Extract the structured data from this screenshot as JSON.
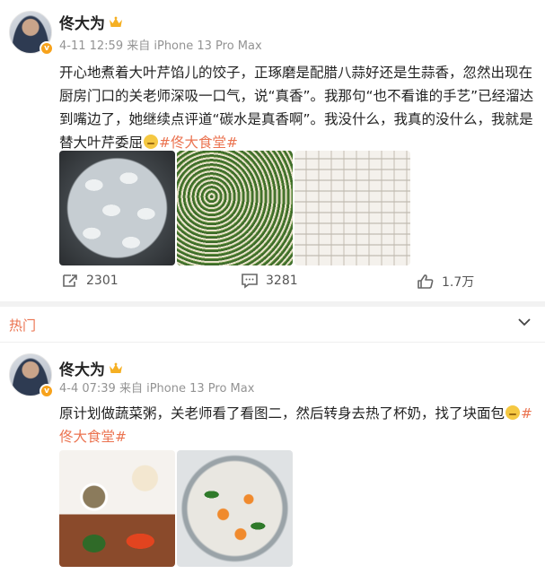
{
  "post1": {
    "author": "佟大为",
    "meta": "4-11 12:59  来自 iPhone 13 Pro Max",
    "text_part1": "开心地煮着大叶芹馅儿的饺子，正琢磨是配腊八蒜好还是生蒜香，忽然出现在厨房门口的关老师深吸一口气，说“真香”。我那句“也不看谁的手艺”已经溜达到嘴边了，她继续点评道“碳水是真香啊”。我没什么，我真的没什么，我就是替大叶芹委屈",
    "hashtag": "#佟大食堂#",
    "reposts": "2301",
    "comments": "3281",
    "likes": "1.7万"
  },
  "hot_section": {
    "label": "热门"
  },
  "post2": {
    "author": "佟大为",
    "meta": "4-4 07:39  来自 iPhone 13 Pro Max",
    "text_part1": "原计划做蔬菜粥，关老师看了看图二，然后转身去热了杯奶，找了块面包",
    "hashtag": "#佟大食堂#"
  },
  "colors": {
    "accent": "#eb7350",
    "meta_gray": "#939393",
    "verified": "#f7a21b"
  }
}
